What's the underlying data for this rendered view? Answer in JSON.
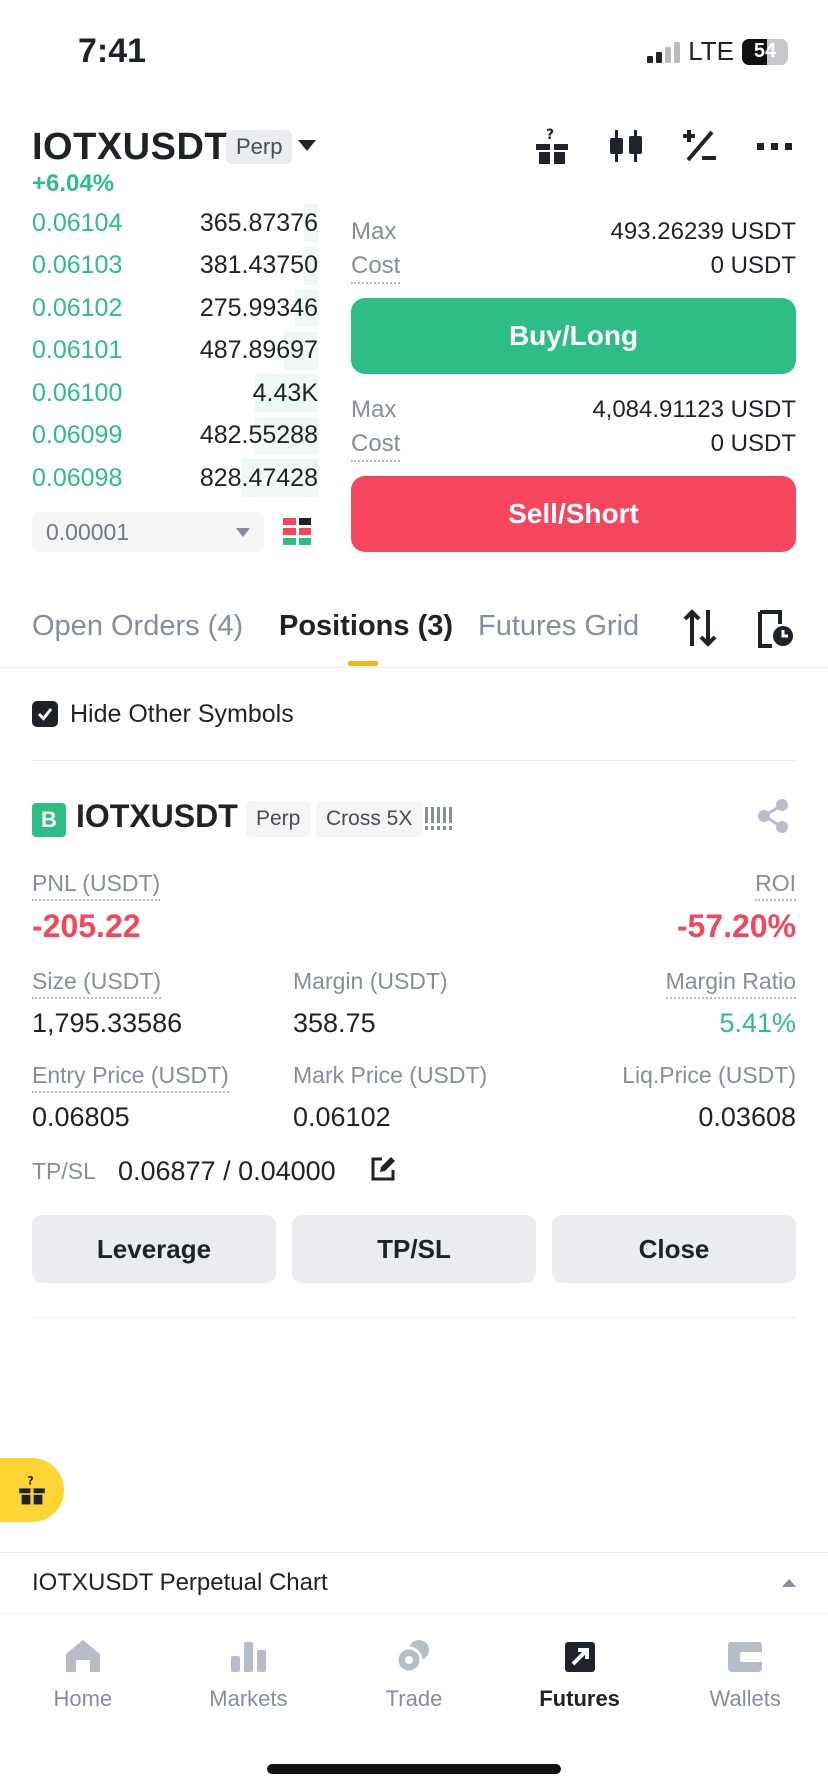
{
  "status": {
    "time": "7:41",
    "network": "LTE",
    "battery": "54",
    "battery_level": 0.54
  },
  "header": {
    "symbol": "IOTXUSDT",
    "contract_tag": "Perp",
    "change": "+6.04%",
    "icons": [
      "gift-box-icon",
      "candlestick-icon",
      "percent-icon",
      "more-icon"
    ]
  },
  "order_book": {
    "rows": [
      {
        "price": "0.06104",
        "qty": "365.87376",
        "depth": 0.05
      },
      {
        "price": "0.06103",
        "qty": "381.43750",
        "depth": 0.05
      },
      {
        "price": "0.06102",
        "qty": "275.99346",
        "depth": 0.08
      },
      {
        "price": "0.06101",
        "qty": "487.89697",
        "depth": 0.12
      },
      {
        "price": "0.06100",
        "qty": "4.43K",
        "depth": 0.22
      },
      {
        "price": "0.06099",
        "qty": "482.55288",
        "depth": 0.22
      },
      {
        "price": "0.06098",
        "qty": "828.47428",
        "depth": 0.27
      }
    ],
    "tick_size": "0.00001"
  },
  "trade_panel": {
    "buy": {
      "max_label": "Max",
      "max_value": "493.26239 USDT",
      "cost_label": "Cost",
      "cost_value": "0 USDT",
      "button": "Buy/Long"
    },
    "sell": {
      "max_label": "Max",
      "max_value": "4,084.91123 USDT",
      "cost_label": "Cost",
      "cost_value": "0 USDT",
      "button": "Sell/Short"
    }
  },
  "tabs": [
    {
      "label": "Open Orders (4)"
    },
    {
      "label": "Positions (3)"
    },
    {
      "label": "Futures Grid"
    }
  ],
  "filter": {
    "hide_other_label": "Hide Other Symbols",
    "checked": true
  },
  "position": {
    "side_badge": "B",
    "symbol": "IOTXUSDT",
    "contract_tag": "Perp",
    "margin_mode": "Cross 5X",
    "pnl_label": "PNL (USDT)",
    "pnl_value": "-205.22",
    "roi_label": "ROI",
    "roi_value": "-57.20%",
    "size_label": "Size (USDT)",
    "size_value": "1,795.33586",
    "margin_label": "Margin (USDT)",
    "margin_value": "358.75",
    "margin_ratio_label": "Margin Ratio",
    "margin_ratio_value": "5.41%",
    "entry_label": "Entry Price (USDT)",
    "entry_value": "0.06805",
    "mark_label": "Mark Price (USDT)",
    "mark_value": "0.06102",
    "liq_label": "Liq.Price (USDT)",
    "liq_value": "0.03608",
    "tpsl_label": "TP/SL",
    "tpsl_value": "0.06877 / 0.04000",
    "actions": {
      "leverage": "Leverage",
      "tpsl": "TP/SL",
      "close": "Close"
    }
  },
  "chart_bar": {
    "label": "IOTXUSDT Perpetual  Chart"
  },
  "nav": [
    {
      "label": "Home",
      "icon": "home-icon"
    },
    {
      "label": "Markets",
      "icon": "markets-icon"
    },
    {
      "label": "Trade",
      "icon": "trade-icon"
    },
    {
      "label": "Futures",
      "icon": "futures-icon",
      "active": true
    },
    {
      "label": "Wallets",
      "icon": "wallet-icon"
    }
  ],
  "colors": {
    "green": "#2ebd85",
    "red": "#f6465d",
    "accent": "#f0b90b",
    "fab": "#fcd535"
  }
}
